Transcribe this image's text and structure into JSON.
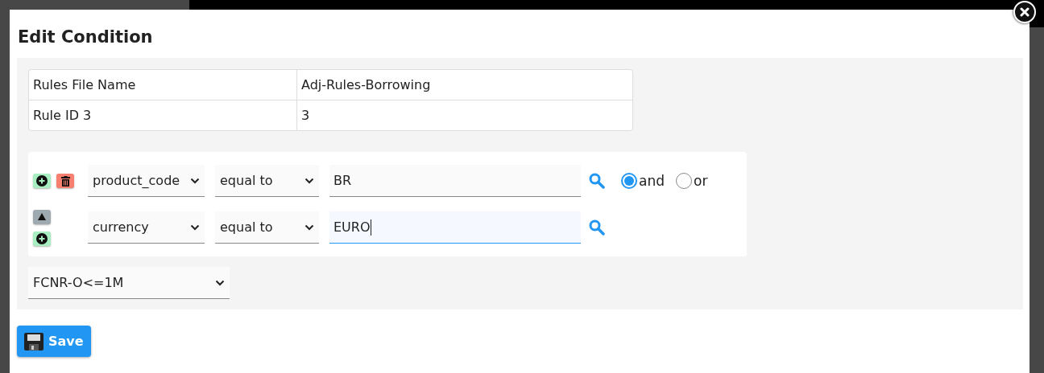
{
  "dialog": {
    "title": "Edit Condition",
    "info_rows": [
      {
        "label": "Rules File Name",
        "value": "Adj-Rules-Borrowing"
      },
      {
        "label": "Rule ID 3",
        "value": "3"
      }
    ],
    "conditions": [
      {
        "controls": [
          {
            "kind": "add"
          },
          {
            "kind": "delete"
          }
        ],
        "field": "product_code",
        "operator": "equal to",
        "value": "BR",
        "focused": false,
        "joiners": [
          {
            "label": "and",
            "selected": true
          },
          {
            "label": "or",
            "selected": false
          }
        ]
      },
      {
        "controls": [
          {
            "kind": "up"
          },
          {
            "kind": "add"
          }
        ],
        "field": "currency",
        "operator": "equal to",
        "value": "EURO",
        "focused": true
      }
    ],
    "result": "FCNR-O<=1M",
    "save_label": "Save"
  }
}
